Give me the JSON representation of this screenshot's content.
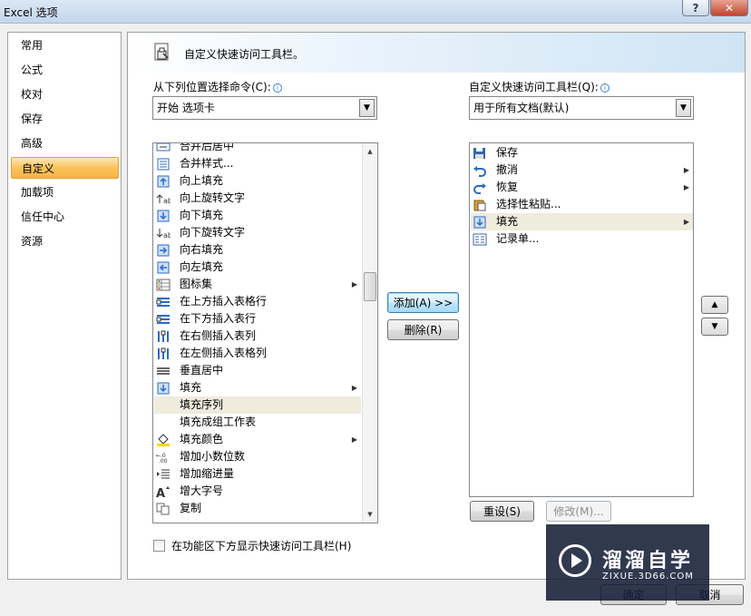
{
  "window": {
    "title": "Excel 选项",
    "help": "?",
    "close": "✕"
  },
  "nav": {
    "items": [
      {
        "label": "常用",
        "selected": false
      },
      {
        "label": "公式",
        "selected": false
      },
      {
        "label": "校对",
        "selected": false
      },
      {
        "label": "保存",
        "selected": false
      },
      {
        "label": "高级",
        "selected": false
      },
      {
        "label": "自定义",
        "selected": true
      },
      {
        "label": "加载项",
        "selected": false
      },
      {
        "label": "信任中心",
        "selected": false
      },
      {
        "label": "资源",
        "selected": false
      }
    ]
  },
  "header": {
    "title": "自定义快速访问工具栏。"
  },
  "left_panel": {
    "label": "从下列位置选择命令(C):",
    "combo_value": "开始 选项卡",
    "commands": [
      {
        "label": "合并后居中",
        "icon": "merge-center-icon",
        "submenu": false
      },
      {
        "label": "合并样式...",
        "icon": "merge-styles-icon",
        "submenu": false
      },
      {
        "label": "向上填充",
        "icon": "fill-up-icon",
        "submenu": false
      },
      {
        "label": "向上旋转文字",
        "icon": "rotate-text-up-icon",
        "submenu": false
      },
      {
        "label": "向下填充",
        "icon": "fill-down-icon",
        "submenu": false
      },
      {
        "label": "向下旋转文字",
        "icon": "rotate-text-down-icon",
        "submenu": false
      },
      {
        "label": "向右填充",
        "icon": "fill-right-icon",
        "submenu": false
      },
      {
        "label": "向左填充",
        "icon": "fill-left-icon",
        "submenu": false
      },
      {
        "label": "图标集",
        "icon": "icon-sets-icon",
        "submenu": true
      },
      {
        "label": "在上方插入表格行",
        "icon": "insert-row-above-icon",
        "submenu": false
      },
      {
        "label": "在下方插入表行",
        "icon": "insert-row-below-icon",
        "submenu": false
      },
      {
        "label": "在右侧插入表列",
        "icon": "insert-col-right-icon",
        "submenu": false
      },
      {
        "label": "在左侧插入表格列",
        "icon": "insert-col-left-icon",
        "submenu": false
      },
      {
        "label": "垂直居中",
        "icon": "middle-align-icon",
        "submenu": false
      },
      {
        "label": "填充",
        "icon": "fill-icon",
        "submenu": true
      },
      {
        "label": "填充序列",
        "icon": "",
        "submenu": false,
        "highlight": true
      },
      {
        "label": "填充成组工作表",
        "icon": "",
        "submenu": false
      },
      {
        "label": "填充颜色",
        "icon": "fill-color-icon",
        "submenu": true
      },
      {
        "label": "增加小数位数",
        "icon": "increase-decimal-icon",
        "submenu": false
      },
      {
        "label": "增加缩进量",
        "icon": "increase-indent-icon",
        "submenu": false
      },
      {
        "label": "增大字号",
        "icon": "grow-font-icon",
        "submenu": false
      },
      {
        "label": "复制",
        "icon": "copy-icon",
        "submenu": false
      }
    ],
    "show_below_label": "在功能区下方显示快速访问工具栏(H)"
  },
  "middle": {
    "add_label": "添加(A) >>",
    "remove_label": "删除(R)"
  },
  "right_panel": {
    "label": "自定义快速访问工具栏(Q):",
    "combo_value": "用于所有文档(默认)",
    "items": [
      {
        "label": "保存",
        "icon": "save-icon",
        "submenu": false
      },
      {
        "label": "撤消",
        "icon": "undo-icon",
        "submenu": true
      },
      {
        "label": "恢复",
        "icon": "redo-icon",
        "submenu": true
      },
      {
        "label": "选择性粘贴...",
        "icon": "paste-special-icon",
        "submenu": false
      },
      {
        "label": "填充",
        "icon": "fill-down-icon",
        "submenu": true,
        "highlight": true
      },
      {
        "label": "记录单...",
        "icon": "form-icon",
        "submenu": false
      }
    ],
    "reset_label": "重设(S)",
    "modify_label": "修改(M)..."
  },
  "footer": {
    "ok_label": "确定",
    "cancel_label": "取消"
  },
  "watermark": {
    "title": "溜溜自学",
    "url": "ZIXUE.3D66.COM"
  }
}
